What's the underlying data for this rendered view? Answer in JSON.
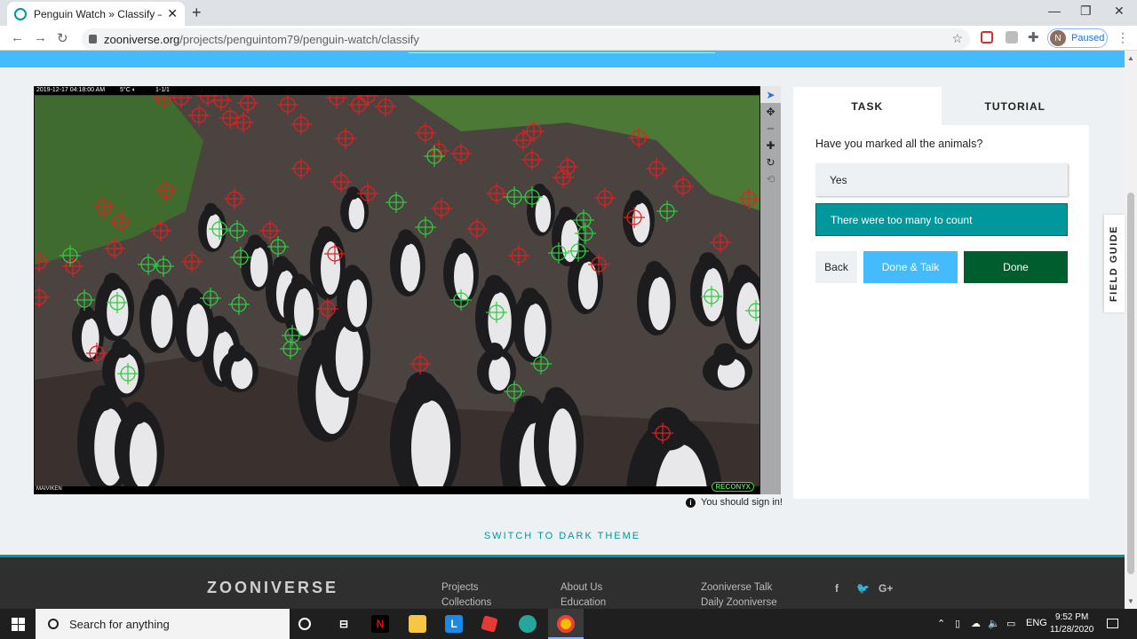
{
  "browser": {
    "tab_title": "Penguin Watch » Classify — Zoo",
    "tab_close": "✕",
    "new_tab": "+",
    "url_host": "zooniverse.org",
    "url_path": "/projects/penguintom79/penguin-watch/classify",
    "profile_initial": "N",
    "profile_status": "Paused",
    "minimize": "—",
    "maximize": "❐",
    "close": "✕"
  },
  "camera": {
    "timestamp": "2019-12-17 04:18:00 AM",
    "temp": "5°C ◐",
    "frame": "1-1/1",
    "camera_name": "MAIVIKEN",
    "brand": "RECONYX"
  },
  "tools": [
    "pointer-icon",
    "move-icon",
    "zoom-out-icon",
    "zoom-in-icon",
    "rotate-icon",
    "reset-icon"
  ],
  "signin_notice": "You should sign in!",
  "panel": {
    "tab_task": "TASK",
    "tab_tutorial": "TUTORIAL",
    "question": "Have you marked all the animals?",
    "answer_yes": "Yes",
    "answer_many": "There were too many to count",
    "back": "Back",
    "done_talk": "Done & Talk",
    "done": "Done"
  },
  "field_guide": "FIELD GUIDE",
  "dark_theme": "SWITCH TO DARK THEME",
  "footer": {
    "logo": "ZOONIVERSE",
    "col1": [
      "Projects",
      "Collections"
    ],
    "col2": [
      "About Us",
      "Education"
    ],
    "col3": [
      "Zooniverse Talk",
      "Daily Zooniverse"
    ],
    "social": [
      "f",
      "🐦",
      "G+"
    ]
  },
  "taskbar": {
    "search_placeholder": "Search for anything",
    "lang": "ENG",
    "time": "9:52 PM",
    "date": "11/28/2020"
  },
  "colors": {
    "accent": "#00979d",
    "blue": "#43bbfd",
    "done_green": "#005d2d",
    "mark_red": "#e02020",
    "mark_green": "#2ecc40"
  }
}
